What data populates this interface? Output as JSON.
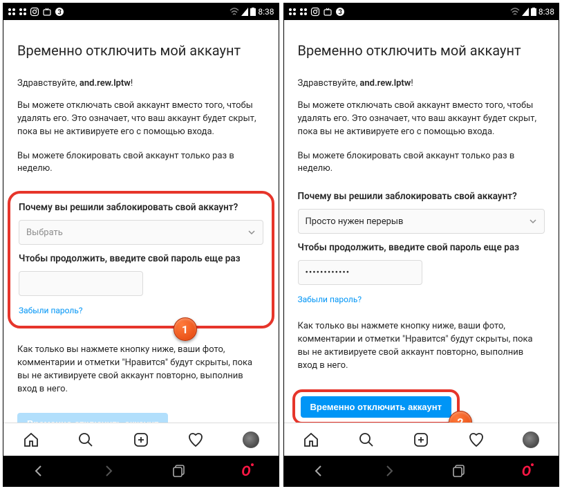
{
  "statusbar": {
    "time": "8:38"
  },
  "page": {
    "title": "Временно отключить мой аккаунт",
    "greeting_prefix": "Здравствуйте, ",
    "username": "and.rew.lptw",
    "greeting_suffix": "!",
    "para1": "Вы можете отключать свой аккаунт вместо того, чтобы удалять его. Это означает, что ваш аккаунт будет скрыт, пока вы не активируете его с помощью входа.",
    "para2": "Вы можете блокировать свой аккаунт только раз в неделю.",
    "reason_label": "Почему вы решили заблокировать свой аккаунт?",
    "reason_placeholder": "Выбрать",
    "reason_selected": "Просто нужен перерыв",
    "password_label": "Чтобы продолжить, введите свой пароль еще раз",
    "password_masked": "••••••••••••",
    "forgot": "Забыли пароль?",
    "info": "Как только вы нажмете кнопку ниже, ваши фото, комментарии и отметки \"Нравится\" будут скрыты, пока вы не активируете свой аккаунт повторно, выполнив вход в него.",
    "button": "Временно отключить аккаунт"
  },
  "badges": {
    "step1": "1",
    "step2": "2"
  }
}
